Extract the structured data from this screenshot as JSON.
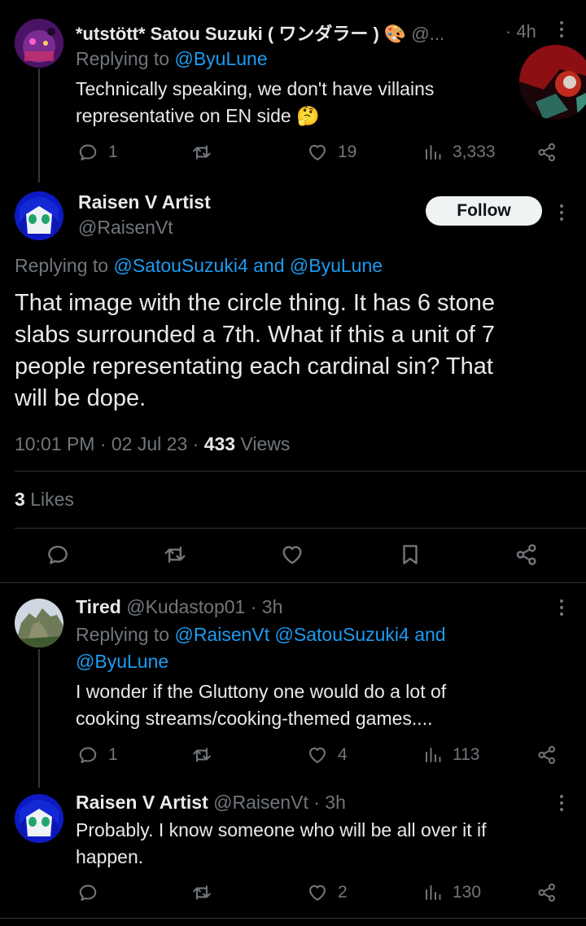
{
  "tweet1": {
    "display_name": "*utstött* Satou Suzuki ( ワンダラー )",
    "emoji": "🎨",
    "handle": "@...",
    "time": "· 4h",
    "replying_label": "Replying to",
    "replying_to": "@ByuLune",
    "text_lines": [
      "Technically speaking, we don't have villains",
      "representative on EN side 🤔"
    ],
    "replies": "1",
    "retweets": "",
    "likes": "19",
    "views": "3,333"
  },
  "main_tweet": {
    "display_name": "Raisen V Artist",
    "handle": "@RaisenVt",
    "follow_label": "Follow",
    "replying_label": "Replying to",
    "replying_to_1": "@SatouSuzuki4",
    "and_label": "and",
    "replying_to_2": "@ByuLune",
    "text_lines": [
      "That image with the circle thing. It has 6 stone",
      "slabs surrounded a 7th. What if this a unit of 7",
      "people representating each cardinal sin? That",
      "will be dope."
    ],
    "time": "10:01 PM · 02 Jul 23 ·",
    "views_count": "433",
    "views_label": "Views",
    "likes_count": "3",
    "likes_label": "Likes"
  },
  "reply1": {
    "display_name": "Tired",
    "handle": "@Kudastop01",
    "time": "· 3h",
    "replying_label": "Replying to",
    "replying_to_1": "@RaisenVt",
    "replying_to_2": "@SatouSuzuki4",
    "and_label": "and",
    "replying_to_3": "@ByuLune",
    "text_lines": [
      "I wonder if the Gluttony one would do a lot of",
      "cooking streams/cooking-themed games...."
    ],
    "replies": "1",
    "likes": "4",
    "views": "113"
  },
  "reply2": {
    "display_name": "Raisen V Artist",
    "handle": "@RaisenVt",
    "time": "· 3h",
    "text_lines": [
      "Probably. I know someone who will be all over it if",
      "happen."
    ],
    "likes": "2",
    "views": "130"
  },
  "icons": {
    "reply": "reply-icon",
    "retweet": "retweet-icon",
    "like": "heart-icon",
    "views": "views-icon",
    "share": "share-icon",
    "bookmark": "bookmark-icon",
    "more": "more-icon"
  },
  "colors": {
    "background": "#000000",
    "text": "#e7e9ea",
    "muted": "#71767b",
    "link": "#1d9bf0",
    "divider": "#2f3336"
  }
}
